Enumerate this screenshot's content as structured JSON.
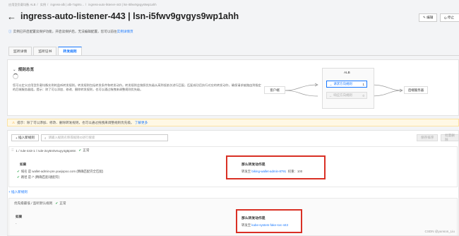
{
  "breadcrumb": [
    "应用型负载均衡 ALB",
    "实例",
    "ingress-alb | alb-7og8ro...",
    "ingress-auto-listener-443 | lsn-i5fwv9gvgys9wp1ahh"
  ],
  "title": "ingress-auto-listener-443 | lsn-i5fwv9gvgys9wp1ahh",
  "top_buttons": [
    "编辑",
    "停止"
  ],
  "notice": {
    "text": "实例已开启配置读保护功能，开启读保护后，无法编辑配置，您可以前往",
    "link": "实例详情页"
  },
  "tabs": [
    "监听详情",
    "监听证书",
    "转发规则"
  ],
  "overview": {
    "title": "规则总览",
    "desc": "您可以定义应用型负载均衡实例的监听转发规则。转发规则包括转发条件和转发动作。转发规则会按照优先级从高到低依次进行匹配，匹配成功后执行对应的转发动作，确保请求被路由到指定的后端服务器组。提示：除了可以添加、修改、删除转发规则，也可以通过拖拽来调整规则优先级。"
  },
  "flow": {
    "client": "客户端",
    "alb": "ALB",
    "rule1": "请求方向规则",
    "rule1_count": "1",
    "rule2": "响应方向规则",
    "rule2_count": "0",
    "backend": "后端服务器"
  },
  "warning": {
    "text": "提示：除了可以添加、修改、删除转发规则，也可以通过拖拽来调整规则优先级。",
    "link": "了解更多"
  },
  "toolbar": {
    "add_label": "插入新规则",
    "search_placeholder": "请输入规则名称或规则ID进行搜索",
    "btn1": "保存排序",
    "btn2": "批量删除"
  },
  "rule1": {
    "header": "1 / rule-443-1 / rule-2xy5n0vnuyy4g6pn6n",
    "status": "正常",
    "if_label": "如果",
    "conditions": [
      "域名 是 wallet-admin-pre.yuwjopoo.com (精确匹配完全匹配)",
      "路径 是 /* (精确匹配/通配符)"
    ],
    "action_title": "那么转发动作是",
    "forward_prefix": "转发至",
    "forward_target": "biking-wallet-admin-8791",
    "weight": "权重：100"
  },
  "insert_rule": "插入新规则",
  "default_rule": {
    "header": "优先级最低 / 监听默认规则",
    "status": "正常",
    "if_label": "如果",
    "cond": "-",
    "action_title": "那么转发动作是",
    "forward_prefix": "转发至",
    "forward_target": "kube-system-fake-svc-443"
  },
  "watermark": "CSDN @yunson_Liu"
}
